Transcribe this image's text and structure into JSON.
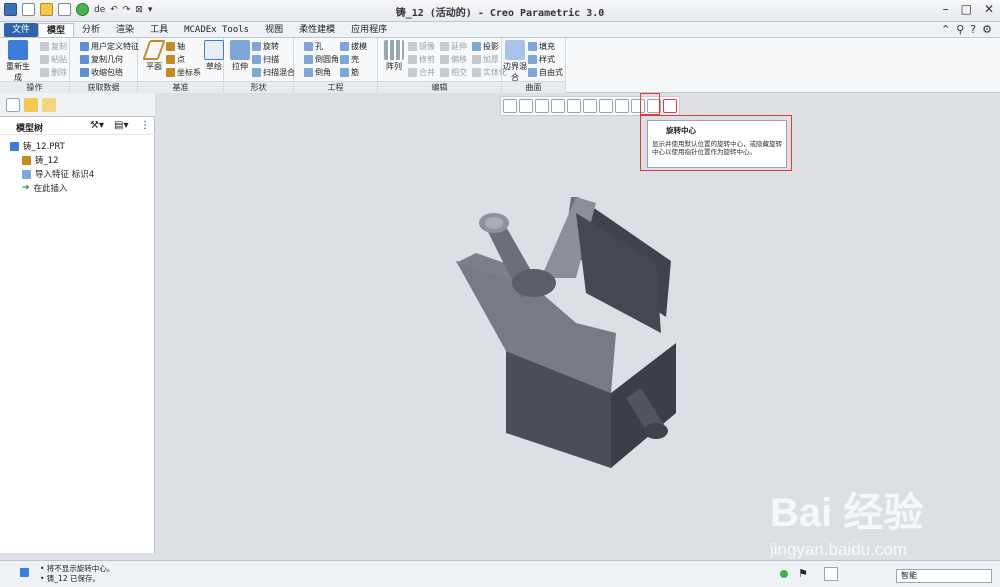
{
  "window": {
    "title": "铸_12 (活动的) - Creo Parametric 3.0",
    "quick_access_text": "de"
  },
  "menu": {
    "tabs": [
      "文件",
      "模型",
      "分析",
      "渲染",
      "工具",
      "MCADEx Tools",
      "视图",
      "柔性建模",
      "应用程序"
    ],
    "active_tab": "模型"
  },
  "ribbon": {
    "groups": {
      "operations": "操作",
      "get_data": "获取数据",
      "datum": "基准",
      "shapes": "形状",
      "engineering": "工程",
      "edit": "编辑",
      "surfaces": "曲面"
    },
    "regenerate": "重新生成",
    "copy": "复制",
    "paste": "粘贴",
    "delete": "删除",
    "udf": "用户定义特征",
    "copy_geom": "复制几何",
    "shrinkwrap": "收缩包络",
    "plane": "平面",
    "axis": "轴",
    "point": "点",
    "csys": "坐标系",
    "sketch": "草绘",
    "extrude": "拉伸",
    "revolve": "旋转",
    "sweep": "扫描",
    "swept_blend": "扫描混合",
    "hole": "孔",
    "round": "倒圆角",
    "chamfer": "倒角",
    "draft": "拔模",
    "shell": "壳",
    "rib": "筋",
    "pattern": "阵列",
    "mirror": "镜像",
    "trim": "修剪",
    "merge": "合并",
    "extend": "延伸",
    "offset": "偏移",
    "intersect": "相交",
    "project": "投影",
    "thicken": "加厚",
    "solidify": "实体化",
    "boundary_blend": "边界混合",
    "fill": "填充",
    "style": "样式",
    "freestyle": "自由式"
  },
  "model_tree": {
    "title": "模型树",
    "items": [
      "铸_12.PRT",
      "铸_12",
      "导入特征 标识4",
      "在此插入"
    ]
  },
  "tooltip": {
    "title": "旋转中心",
    "body": "显示并使用默认位置的旋转中心，或隐藏旋转中心以使用指针位置作为旋转中心。"
  },
  "status": {
    "messages": [
      "• 将不显示旋转中心。",
      "• 铸_12 已保存。"
    ],
    "filter": "智能"
  },
  "watermark": {
    "brand": "Bai  经验",
    "url": "jingyan.baidu.com"
  },
  "colors": {
    "accent": "#2f64ad",
    "model_dark": "#4a4e57",
    "model_light": "#6b7079",
    "highlight": "#e53935"
  }
}
